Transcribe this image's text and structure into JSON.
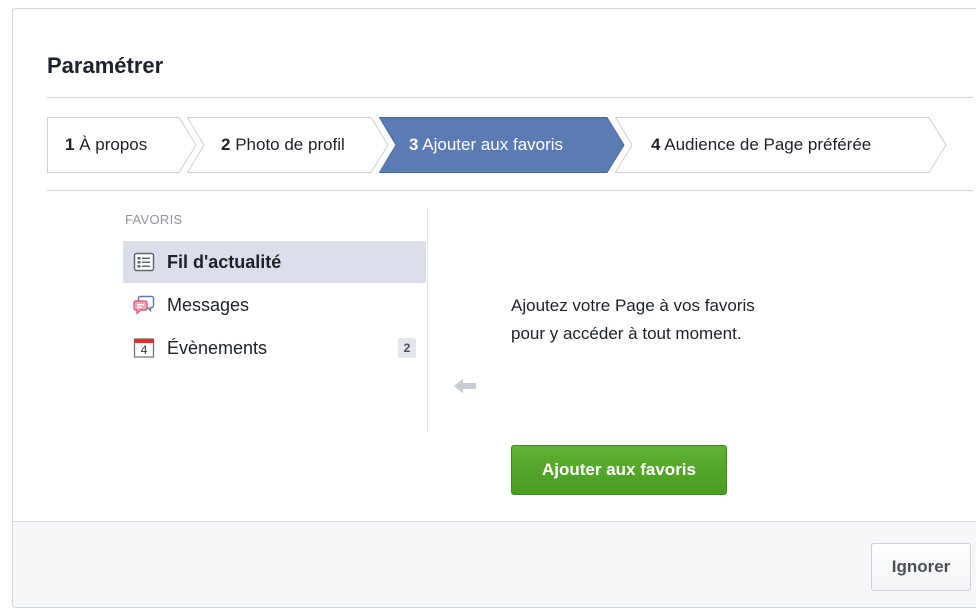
{
  "dialog": {
    "title": "Paramétrer"
  },
  "steps": [
    {
      "number": "1",
      "label": "À propos",
      "state": "done"
    },
    {
      "number": "2",
      "label": "Photo de profil",
      "state": "done"
    },
    {
      "number": "3",
      "label": "Ajouter aux favoris",
      "state": "active"
    },
    {
      "number": "4",
      "label": "Audience de Page préférée",
      "state": "pending"
    }
  ],
  "colors": {
    "active_step": "#5b7bb5",
    "step_border": "#ced0d4",
    "button_green": "#4a9b22"
  },
  "favorites": {
    "heading": "FAVORIS",
    "items": [
      {
        "label": "Fil d'actualité",
        "icon": "news-feed-icon",
        "selected": true
      },
      {
        "label": "Messages",
        "icon": "messages-icon",
        "selected": false
      },
      {
        "label": "Évènements",
        "icon": "calendar-icon",
        "badge": "2",
        "calendar_day": "4",
        "selected": false
      }
    ]
  },
  "main": {
    "description_line1": "Ajoutez votre Page à vos favoris",
    "description_line2": "pour y accéder à tout moment.",
    "add_button_label": "Ajouter aux favoris"
  },
  "footer": {
    "ignore_label": "Ignorer"
  }
}
